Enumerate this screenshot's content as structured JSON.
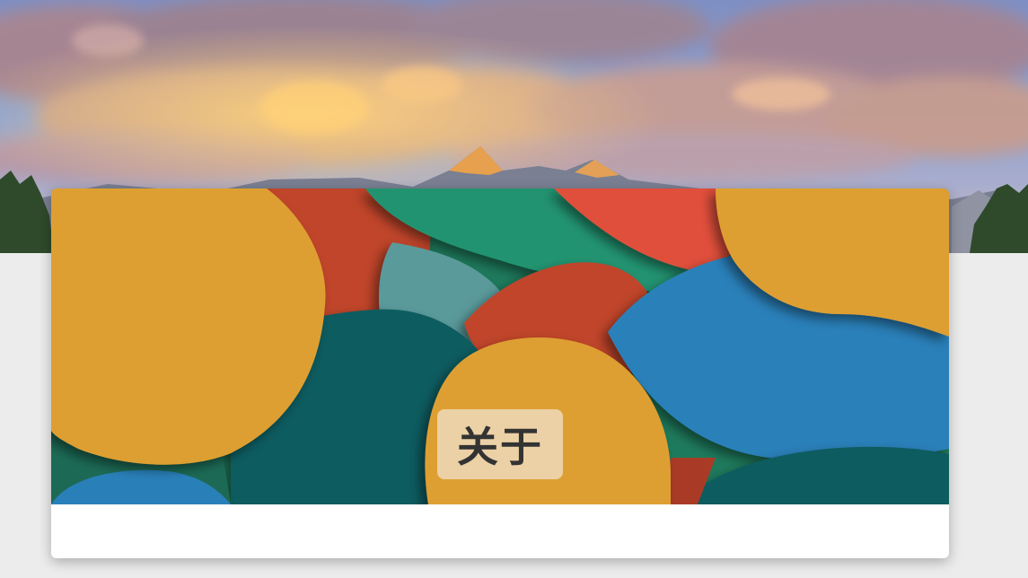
{
  "hero": {
    "image": "mountain-sunset-landscape"
  },
  "about_card": {
    "title": "关于",
    "banner_image": "colorful-abstract-blobs",
    "colors": {
      "orange": "#de9f33",
      "blue": "#2980b9",
      "teal": "#0f5b60",
      "green": "#23936f",
      "red": "#c0452b"
    }
  }
}
